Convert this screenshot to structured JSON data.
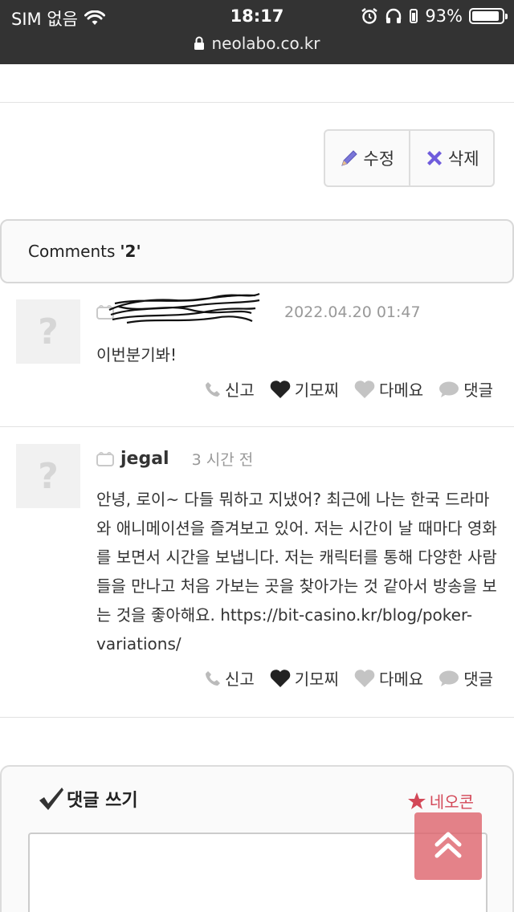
{
  "status_bar": {
    "carrier": "SIM 없음",
    "time": "18:17",
    "battery": "93%",
    "battery_level": 0.93,
    "url": "neolabo.co.kr"
  },
  "post_actions": {
    "edit_label": "수정",
    "delete_label": "삭제"
  },
  "comments_header": {
    "label": "Comments",
    "count": "'2'"
  },
  "comments": [
    {
      "author": "",
      "date": "2022.04.20 01:47",
      "body": "이번분기봐!",
      "avatar_glyph": "?"
    },
    {
      "author": "jegal",
      "date": "3 시간 전",
      "body": "안녕, 로이~ 다들 뭐하고 지냈어? 최근에 나는 한국 드라마와 애니메이션을 즐겨보고 있어. 저는 시간이 날 때마다 영화를 보면서 시간을 보냅니다. 저는 캐릭터를 통해 다양한 사람들을 만나고 처음 가보는 곳을 찾아가는 것 같아서 방송을 보는 것을 좋아해요. https://bit-casino.kr/blog/poker-variations/",
      "avatar_glyph": "?"
    }
  ],
  "comment_actions": {
    "report": "신고",
    "like": "기모찌",
    "dislike": "다메요",
    "reply": "댓글"
  },
  "write_comment": {
    "title": "댓글 쓰기",
    "neocon": "네오콘"
  },
  "colors": {
    "status_bar_bg": "#333333",
    "accent_red": "#d34858",
    "scroll_top_bg": "#de676f",
    "delete_icon": "#6f5cdc"
  }
}
